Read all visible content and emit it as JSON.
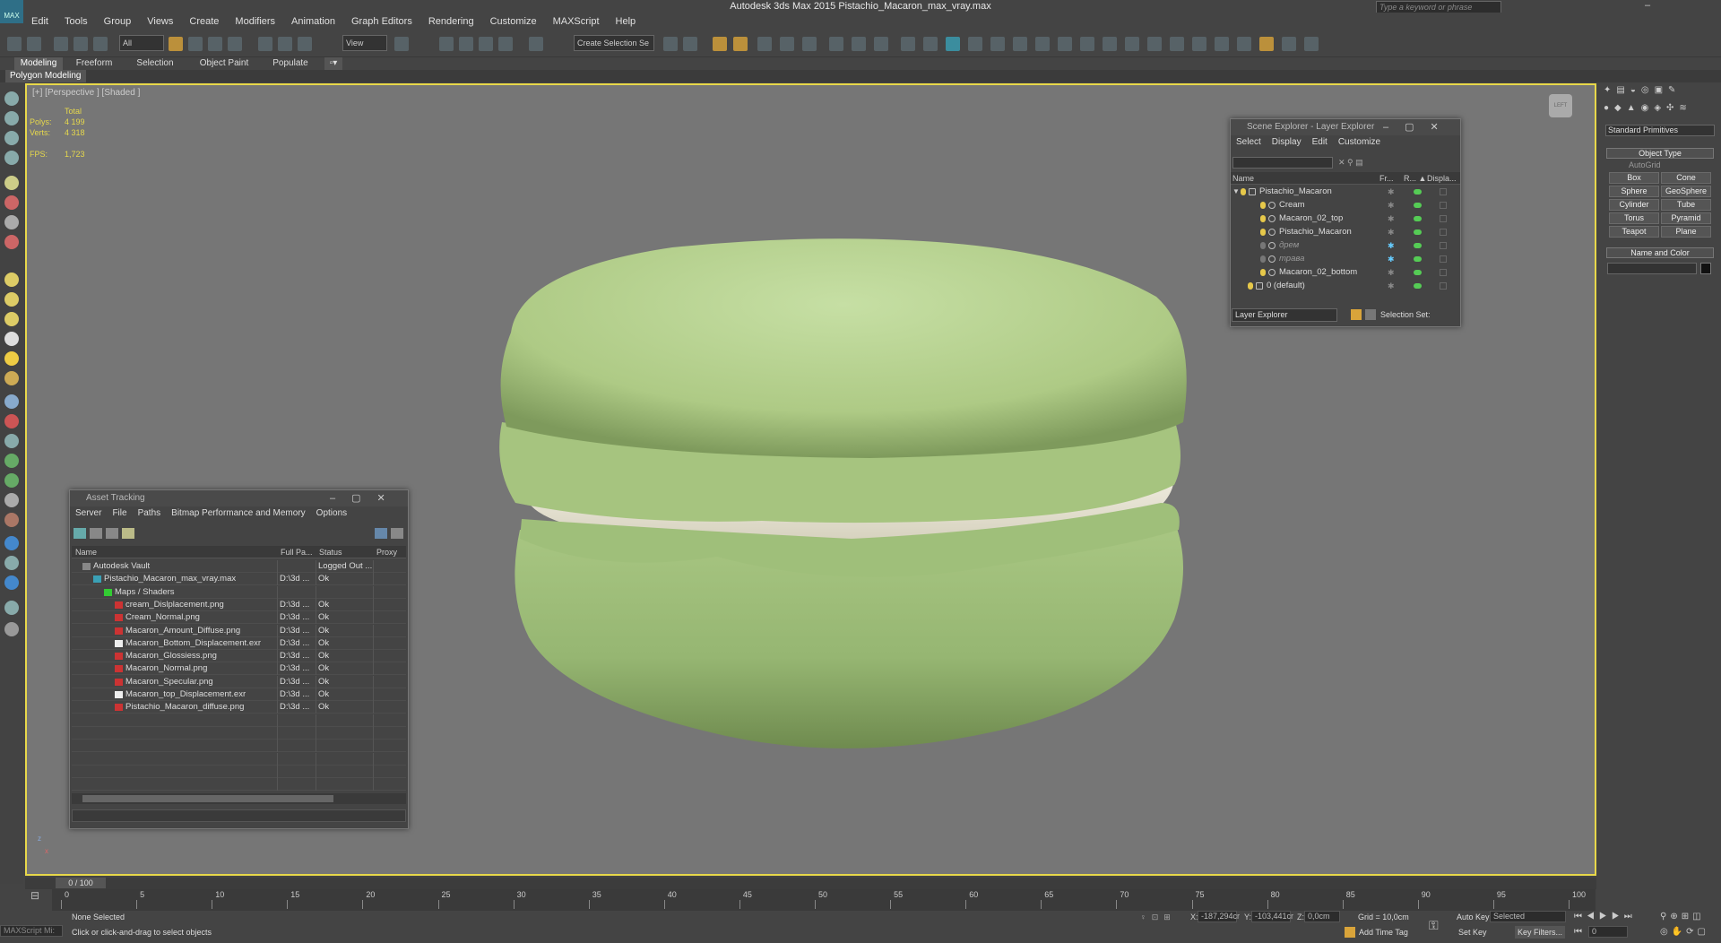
{
  "app": {
    "title": "Autodesk 3ds Max  2015    Pistachio_Macaron_max_vray.max",
    "logo": "MAX",
    "search_placeholder": "Type a keyword or phrase"
  },
  "menus": [
    "Edit",
    "Tools",
    "Group",
    "Views",
    "Create",
    "Modifiers",
    "Animation",
    "Graph Editors",
    "Rendering",
    "Customize",
    "MAXScript",
    "Help"
  ],
  "toolbar": {
    "filter": "All",
    "refcoord": "View",
    "named_sel": "Create Selection Se"
  },
  "ribbon": {
    "tabs": [
      "Modeling",
      "Freeform",
      "Selection",
      "Object Paint",
      "Populate"
    ],
    "sub": "Polygon Modeling"
  },
  "viewport": {
    "label": "[+] [Perspective ] [Shaded ]",
    "stats_title": "Total",
    "polys_label": "Polys:",
    "polys": "4 199",
    "verts_label": "Verts:",
    "verts": "4 318",
    "fps_label": "FPS:",
    "fps": "1,723",
    "axis_z": "z",
    "axis_x": "x",
    "viewcube": "LEFT"
  },
  "scene_explorer": {
    "title": "Scene Explorer - Layer Explorer",
    "menus": [
      "Select",
      "Display",
      "Edit",
      "Customize"
    ],
    "cols": [
      "Name",
      "Fr...",
      "R... ▲",
      "Displa..."
    ],
    "rows": [
      {
        "name": "Pistachio_Macaron",
        "indent": 0
      },
      {
        "name": "Cream",
        "indent": 2
      },
      {
        "name": "Macaron_02_top",
        "indent": 2
      },
      {
        "name": "Pistachio_Macaron",
        "indent": 2
      },
      {
        "name": "дрем",
        "indent": 2,
        "faded": true
      },
      {
        "name": "трава",
        "indent": 2,
        "faded": true
      },
      {
        "name": "Macaron_02_bottom",
        "indent": 2
      },
      {
        "name": "0 (default)",
        "indent": 1
      }
    ],
    "footer_select": "Layer Explorer",
    "footer_label": "Selection Set:"
  },
  "asset_tracking": {
    "title": "Asset Tracking",
    "menus": [
      "Server",
      "File",
      "Paths",
      "Bitmap Performance and Memory",
      "Options"
    ],
    "cols": [
      "Name",
      "Full Pa...",
      "Status",
      "Proxy Re"
    ],
    "rows": [
      {
        "name": "Autodesk Vault",
        "path": "",
        "status": "Logged Out ...",
        "lvl": 1,
        "icon": "vault-icon"
      },
      {
        "name": "Pistachio_Macaron_max_vray.max",
        "path": "D:\\3d ...",
        "status": "Ok",
        "lvl": 2,
        "icon": "max-file-icon"
      },
      {
        "name": "Maps / Shaders",
        "path": "",
        "status": "",
        "lvl": 3,
        "icon": "maps-icon"
      },
      {
        "name": "cream_Dislplacement.png",
        "path": "D:\\3d ...",
        "status": "Ok",
        "lvl": 4,
        "icon": "bitmap-icon"
      },
      {
        "name": "Cream_Normal.png",
        "path": "D:\\3d ...",
        "status": "Ok",
        "lvl": 4,
        "icon": "bitmap-icon"
      },
      {
        "name": "Macaron_Amount_Diffuse.png",
        "path": "D:\\3d ...",
        "status": "Ok",
        "lvl": 4,
        "icon": "bitmap-icon"
      },
      {
        "name": "Macaron_Bottom_Displacement.exr",
        "path": "D:\\3d ...",
        "status": "Ok",
        "lvl": 4,
        "icon": "exr-icon"
      },
      {
        "name": "Macaron_Glossiess.png",
        "path": "D:\\3d ...",
        "status": "Ok",
        "lvl": 4,
        "icon": "bitmap-icon"
      },
      {
        "name": "Macaron_Normal.png",
        "path": "D:\\3d ...",
        "status": "Ok",
        "lvl": 4,
        "icon": "bitmap-icon"
      },
      {
        "name": "Macaron_Specular.png",
        "path": "D:\\3d ...",
        "status": "Ok",
        "lvl": 4,
        "icon": "bitmap-icon"
      },
      {
        "name": "Macaron_top_Displacement.exr",
        "path": "D:\\3d ...",
        "status": "Ok",
        "lvl": 4,
        "icon": "exr-icon"
      },
      {
        "name": "Pistachio_Macaron_diffuse.png",
        "path": "D:\\3d ...",
        "status": "Ok",
        "lvl": 4,
        "icon": "bitmap-icon"
      }
    ]
  },
  "command_panel": {
    "dropdown": "Standard Primitives",
    "object_type": "Object Type",
    "autogrid": "AutoGrid",
    "buttons": [
      "Box",
      "Cone",
      "Sphere",
      "GeoSphere",
      "Cylinder",
      "Tube",
      "Torus",
      "Pyramid",
      "Teapot",
      "Plane"
    ],
    "name_color": "Name and Color"
  },
  "timeline": {
    "frame": "0 / 100",
    "ticks": [
      "0",
      "5",
      "10",
      "15",
      "20",
      "25",
      "30",
      "35",
      "40",
      "45",
      "50",
      "55",
      "60",
      "65",
      "70",
      "75",
      "80",
      "85",
      "90",
      "95",
      "100"
    ]
  },
  "status": {
    "selection": "None Selected",
    "prompt": "Click or click-and-drag to select objects",
    "maxscript": "MAXScript Mi:",
    "x_label": "X:",
    "x": "-187,294cr",
    "y_label": "Y:",
    "y": "-103,441cr",
    "z_label": "Z:",
    "z": "0,0cm",
    "grid": "Grid = 10,0cm",
    "autokey": "Auto Key",
    "setkey": "Set Key",
    "selected": "Selected",
    "keyfilters": "Key Filters...",
    "addtimetag": "Add Time Tag",
    "frame_field": "0"
  },
  "colors": {
    "viewport_border": "#e8d84a",
    "macaron": "#b9d596",
    "cream": "#e9e5d6"
  }
}
